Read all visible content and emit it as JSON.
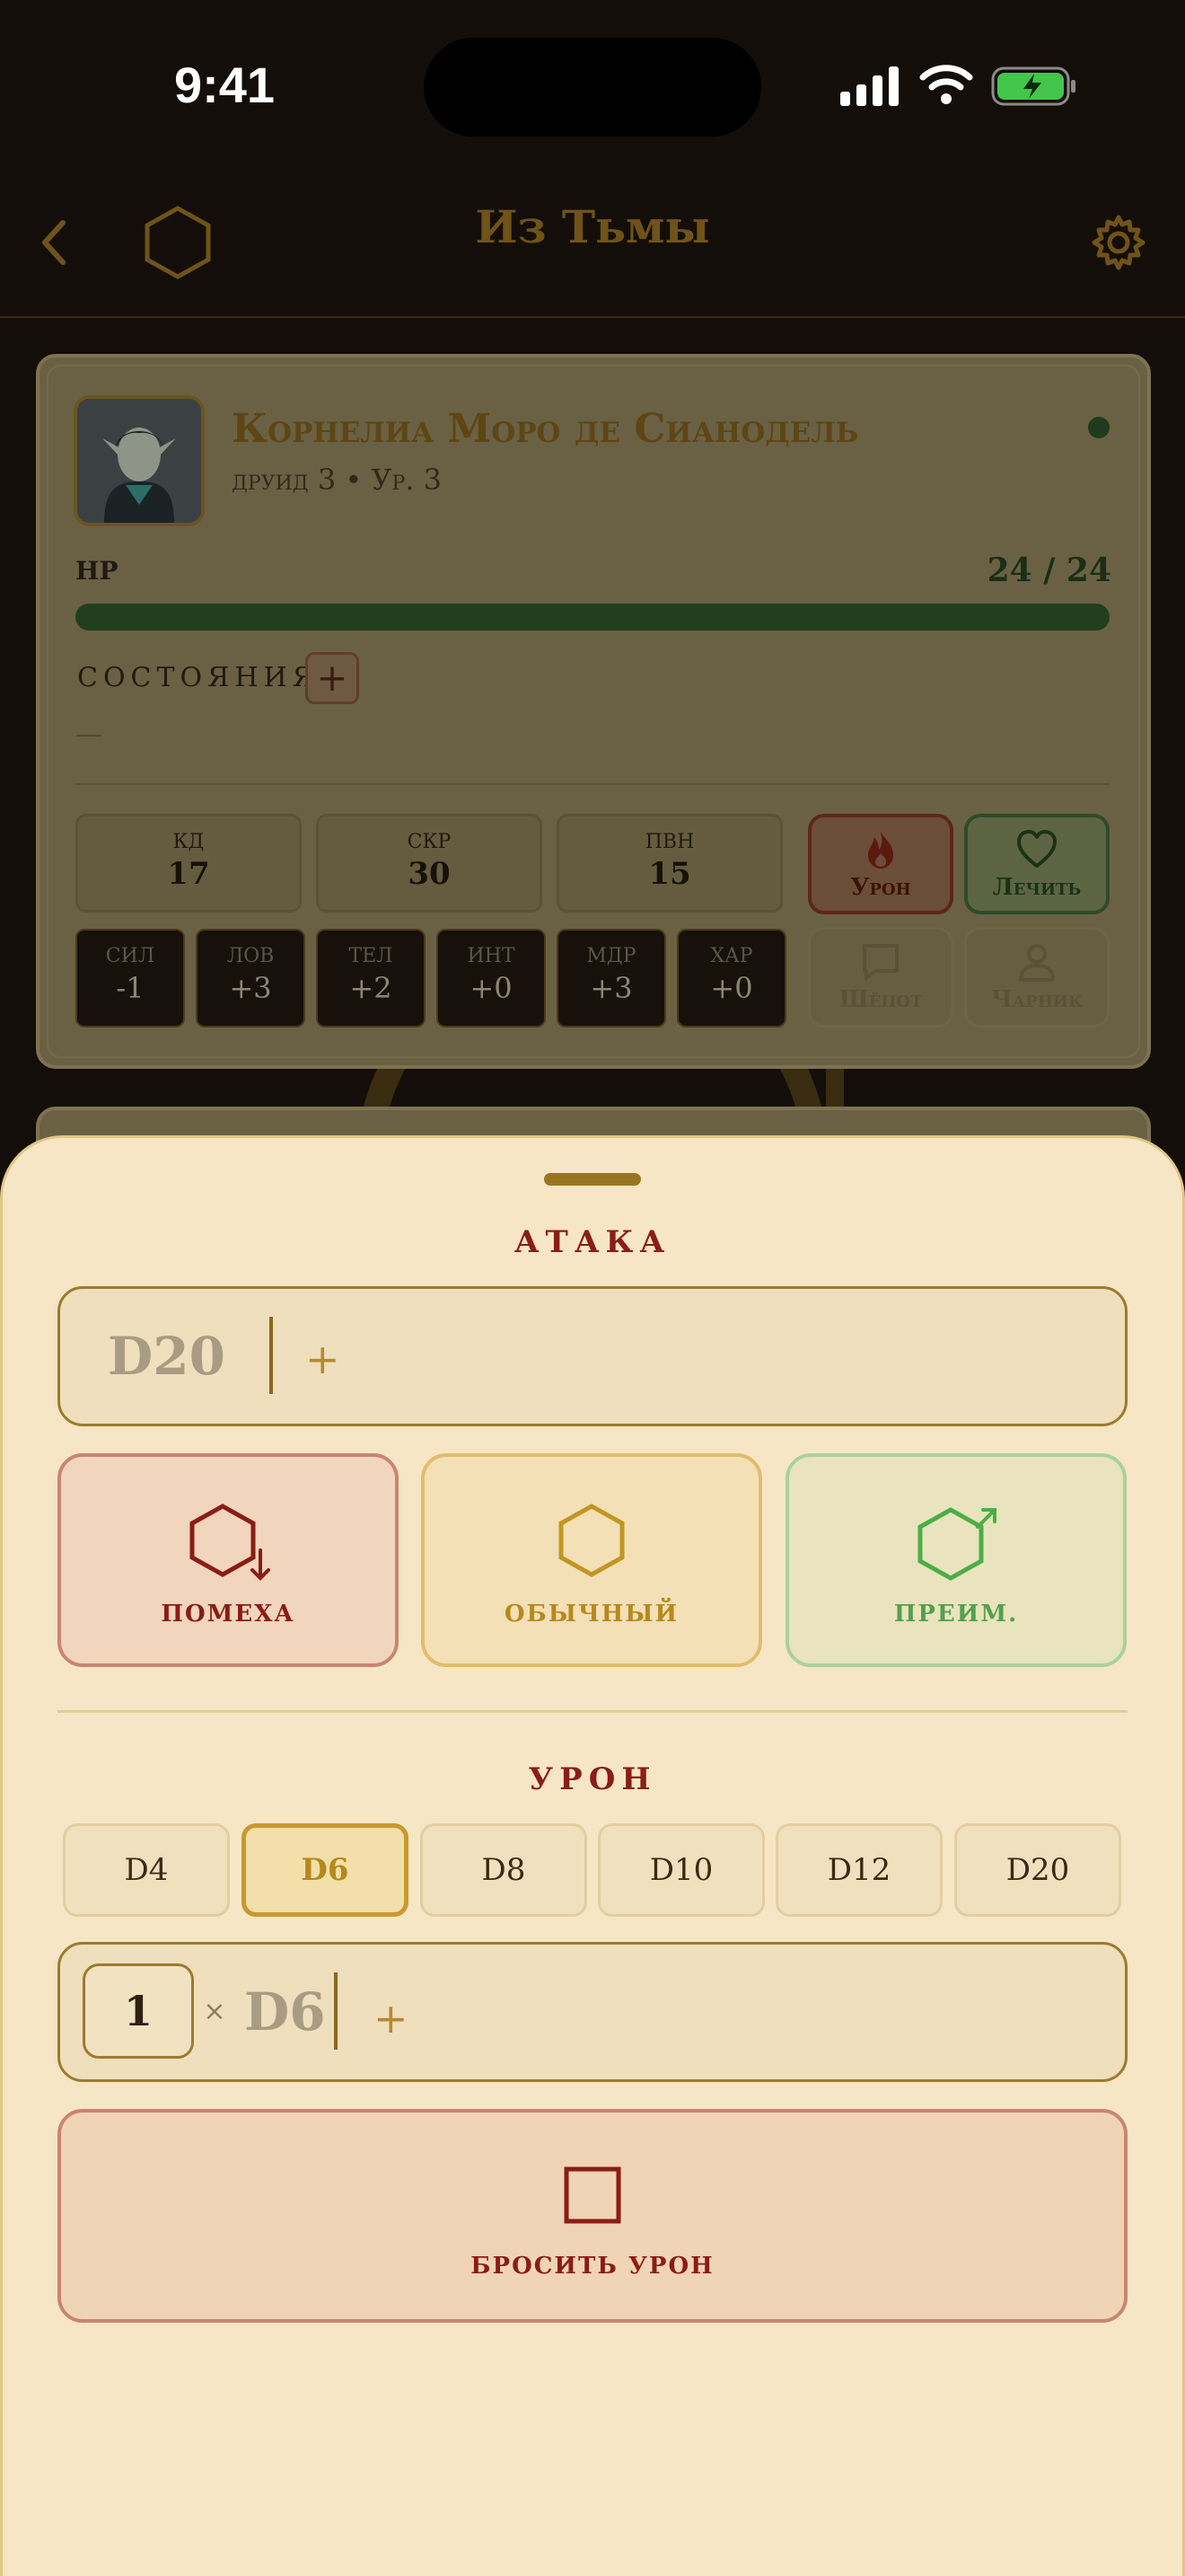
{
  "status_bar": {
    "time": "9:41"
  },
  "nav": {
    "title": "Из Тьмы"
  },
  "character": {
    "name": "Корнелиа Моро де Сианодель",
    "subtitle": "друид 3 • Ур. 3",
    "hp_label": "HP",
    "hp_value": "24 / 24",
    "hp_fraction": 1.0,
    "conditions_label": "СОСТОЯНИЯ",
    "conditions_add": "+",
    "conditions_empty": "—",
    "stats": [
      {
        "label": "КД",
        "value": "17"
      },
      {
        "label": "СКР",
        "value": "30"
      },
      {
        "label": "ПВН",
        "value": "15"
      }
    ],
    "abilities": [
      {
        "label": "СИЛ",
        "value": "-1"
      },
      {
        "label": "ЛОВ",
        "value": "+3"
      },
      {
        "label": "ТЕЛ",
        "value": "+2"
      },
      {
        "label": "ИНТ",
        "value": "+0"
      },
      {
        "label": "МДР",
        "value": "+3"
      },
      {
        "label": "ХАР",
        "value": "+0"
      }
    ],
    "actions": {
      "damage": "Урон",
      "heal": "Лечить",
      "whisper": "Шёпот",
      "char": "Чарник"
    }
  },
  "sheet": {
    "attack_title": "АТАКА",
    "attack_die": "D20",
    "attack_plus": "+",
    "modes": {
      "disadvantage": "ПОМЕХА",
      "normal": "ОБЫЧНЫЙ",
      "advantage": "ПРЕИМ."
    },
    "damage_title": "УРОН",
    "dice": [
      "D4",
      "D6",
      "D8",
      "D10",
      "D12",
      "D20"
    ],
    "selected_die": "D6",
    "count": "1",
    "times": "×",
    "damage_die": "D6",
    "damage_plus": "+",
    "roll_label": "БРОСИТЬ УРОН"
  },
  "colors": {
    "accent_gold": "#b7891c",
    "danger": "#8a1d14",
    "success": "#54a04d",
    "sheet_bg": "#f7e6c6"
  }
}
